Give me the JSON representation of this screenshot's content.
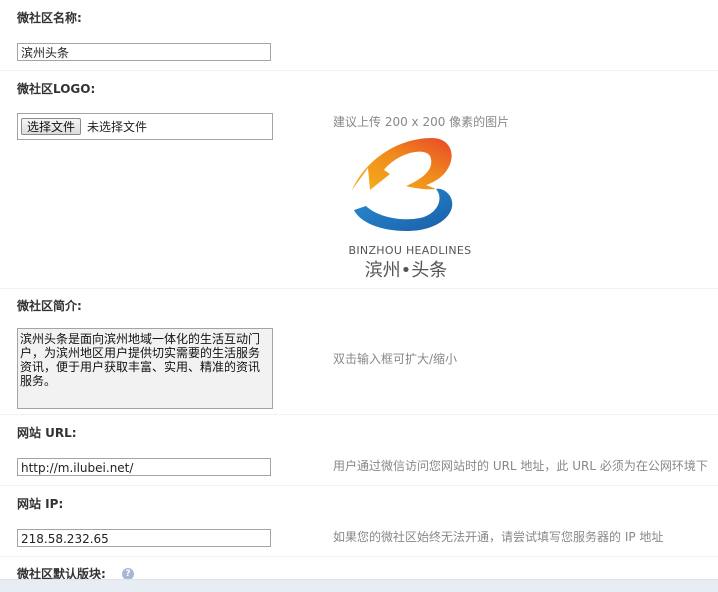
{
  "form": {
    "name": {
      "label": "微社区名称:",
      "value": "滨州头条"
    },
    "logo": {
      "label": "微社区LOGO:",
      "choose_button": "选择文件",
      "file_status": "未选择文件",
      "hint": "建议上传 200 x 200 像素的图片",
      "preview_text_en": "BINZHOU HEADLINES",
      "preview_text_cn": "滨州•头条",
      "icon": "logo-b-icon"
    },
    "intro": {
      "label": "微社区简介:",
      "value": "滨州头条是面向滨州地域一体化的生活互动门户，为滨州地区用户提供切实需要的生活服务资讯，便于用户获取丰富、实用、精准的资讯服务。",
      "hint": "双击输入框可扩大/缩小"
    },
    "url": {
      "label": "网站 URL:",
      "value": "http://m.ilubei.net/",
      "hint": "用户通过微信访问您网站时的 URL 地址，此 URL 必须为在公网环境下"
    },
    "ip": {
      "label": "网站 IP:",
      "value": "218.58.232.65",
      "hint": "如果您的微社区始终无法开通，请尝试填写您服务器的 IP 地址"
    },
    "default_board": {
      "label": "微社区默认版块:",
      "icon": "help-icon",
      "icon_glyph": "?"
    }
  },
  "colors": {
    "logo_orange": "#f08a1c",
    "logo_red": "#e8472a",
    "logo_blue": "#1d6fb8",
    "logo_text": "#555555"
  }
}
